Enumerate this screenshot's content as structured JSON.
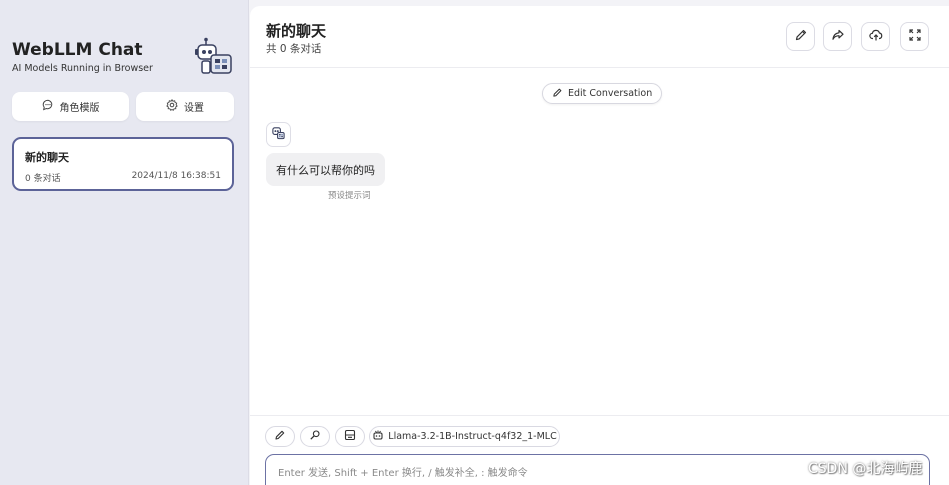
{
  "sidebar": {
    "title": "WebLLM Chat",
    "subtitle": "AI Models Running in Browser",
    "mask_button": "角色模版",
    "settings_button": "设置",
    "chat_item": {
      "title": "新的聊天",
      "count": "0 条对话",
      "date": "2024/11/8 16:38:51"
    }
  },
  "header": {
    "title": "新的聊天",
    "subtitle": "共 0 条对话",
    "icons": [
      "edit-icon",
      "share-icon",
      "cloud-upload-icon",
      "fullscreen-icon"
    ]
  },
  "chat": {
    "edit_conversation": "Edit Conversation",
    "bot_message": "有什么可以帮你的吗",
    "bot_message_meta": "预设提示词"
  },
  "composer": {
    "model_name": "Llama-3.2-1B-Instruct-q4f32_1-MLC",
    "placeholder": "Enter 发送, Shift + Enter 换行, / 触发补全, : 触发命令"
  },
  "watermark": "CSDN @北海屿鹿",
  "colors": {
    "accent": "#5c6398",
    "sidebar_bg": "#e7e8f1"
  }
}
